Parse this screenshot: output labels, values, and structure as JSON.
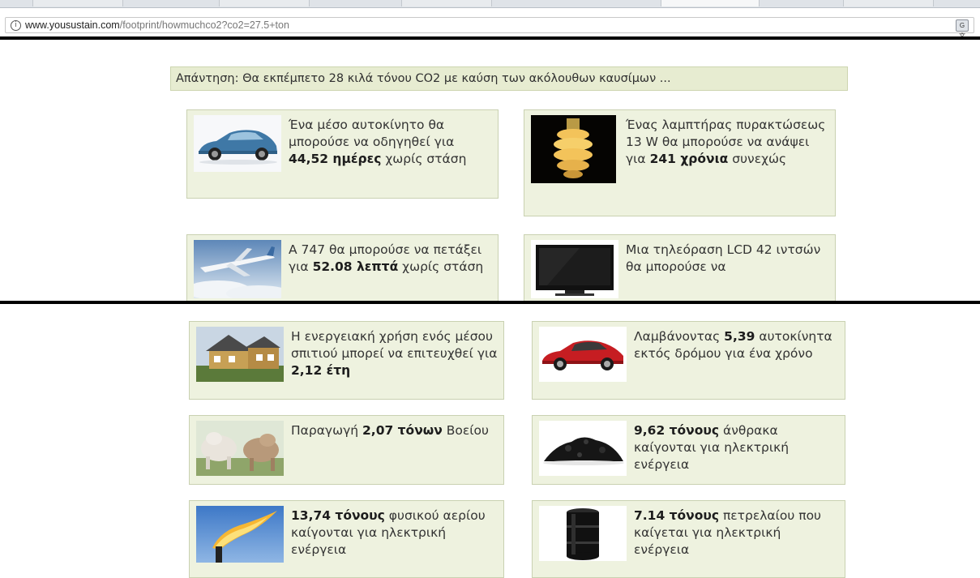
{
  "browser": {
    "url_domain": "www.yousustain.com",
    "url_path": "/footprint/howmuchco2?co2=27.5+ton",
    "info_icon": "info-icon",
    "translate_icon": "translate-icon"
  },
  "answer": {
    "text": "Απάντηση: Θα εκπέμπετο 28 κιλά τόνου CO2 με καύση των ακόλουθων καυσίμων ..."
  },
  "cards": [
    {
      "image": "car-image",
      "pre": "Ένα μέσο αυτοκίνητο θα μπορούσε να οδηγηθεί για ",
      "bold": "44,52 ημέρες",
      "post": " χωρίς στάση"
    },
    {
      "image": "cfl-bulb-image",
      "pre": "Ένας λαμπτήρας πυρακτώσεως 13 W θα μπορούσε να ανάψει για ",
      "bold": "241 χρόνια",
      "post": " συνεχώς"
    },
    {
      "image": "airplane-image",
      "pre": "Α 747 θα μπορούσε να πετάξει για ",
      "bold": "52.08 λεπτά",
      "post": " χωρίς στάση"
    },
    {
      "image": "lcd-tv-image",
      "pre": "Μια τηλεόραση LCD 42 ιντσών θα μπορούσε να",
      "bold": "",
      "post": ""
    },
    {
      "image": "house-image",
      "pre": "Η ενεργειακή χρήση ενός μέσου σπιτιού μπορεί να επιτευχθεί για ",
      "bold": "2,12 έτη",
      "post": ""
    },
    {
      "image": "red-car-image",
      "pre": "Λαμβάνοντας ",
      "bold": "5,39",
      "post": " αυτοκίνητα εκτός δρόμου για ένα χρόνο"
    },
    {
      "image": "cattle-image",
      "pre": "Παραγωγή ",
      "bold": "2,07 τόνων",
      "post": " Βοείου"
    },
    {
      "image": "coal-image",
      "pre": "",
      "bold": "9,62 τόνους",
      "post": " άνθρακα καίγονται για ηλεκτρική ενέργεια"
    },
    {
      "image": "gas-flare-image",
      "pre": "",
      "bold": "13,74 τόνους",
      "post": " φυσικού αερίου καίγονται για ηλεκτρική ενέργεια"
    },
    {
      "image": "oil-barrel-image",
      "pre": "",
      "bold": "7.14 τόνους",
      "post": " πετρελαίου που καίγεται για ηλεκτρική ενέργεια"
    }
  ]
}
